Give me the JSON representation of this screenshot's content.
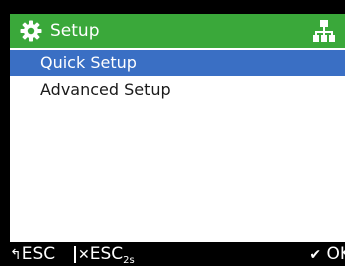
{
  "title_bar": {
    "title": "Setup",
    "icon": "gear-icon",
    "right_icon": "network-tree-icon",
    "color": "#3aa83a"
  },
  "menu": {
    "items": [
      {
        "label": "Quick Setup",
        "selected": true
      },
      {
        "label": "Advanced Setup",
        "selected": false
      }
    ],
    "selection_color": "#3a6fc4"
  },
  "softkeys": {
    "back_label": "ESC",
    "close_label": "ESC",
    "close_subscript": "2s",
    "ok_label": "OK"
  }
}
